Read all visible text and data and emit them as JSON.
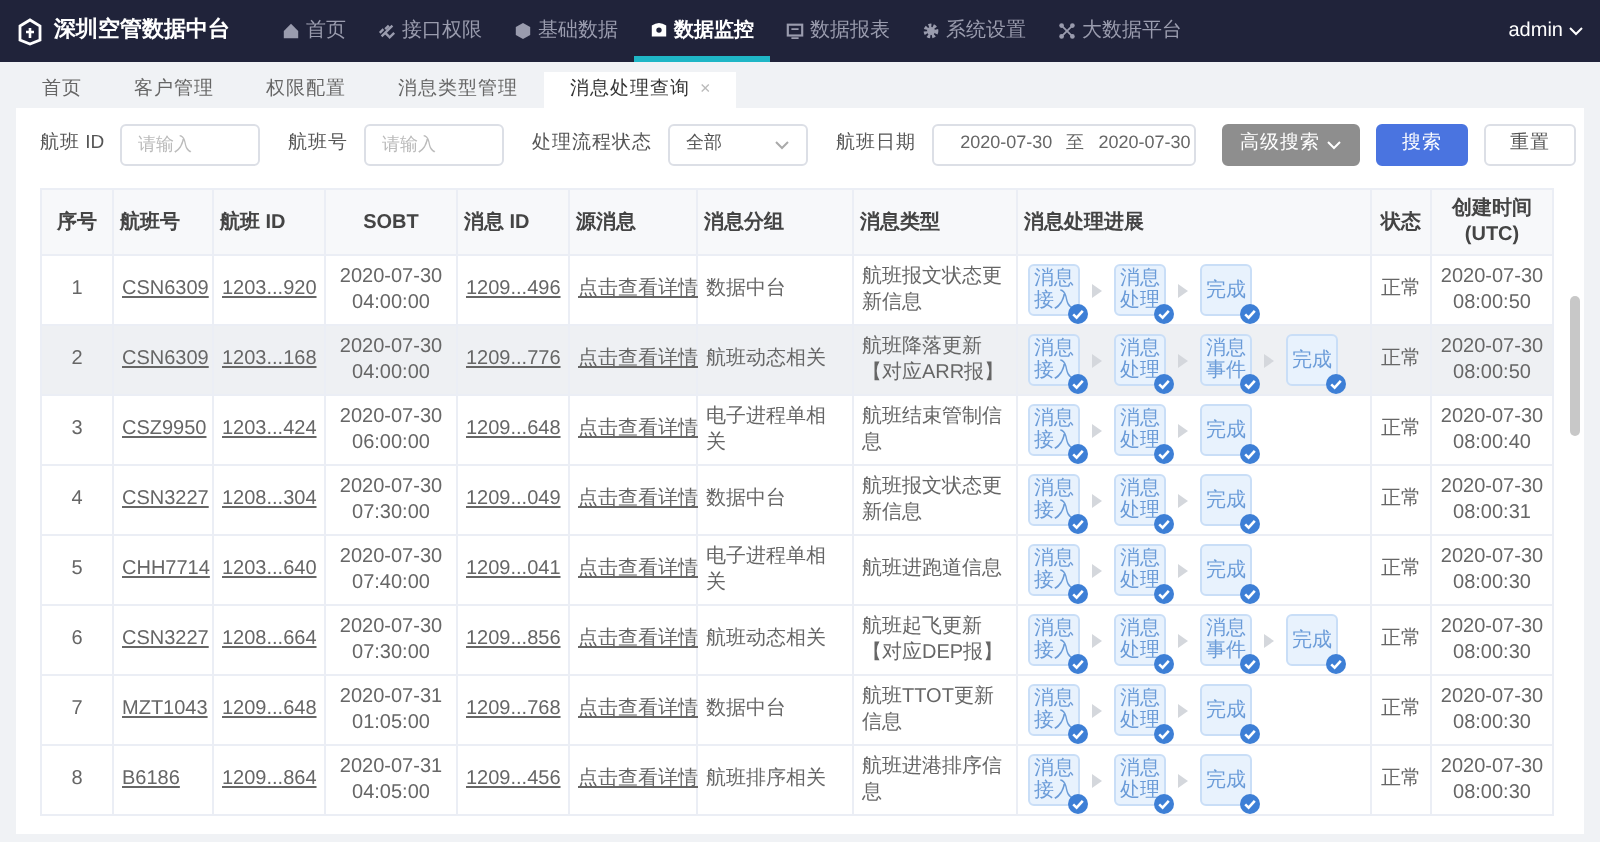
{
  "app": {
    "title": "深圳空管数据中台",
    "user": "admin"
  },
  "nav": [
    {
      "label": "首页",
      "selected": false
    },
    {
      "label": "接口权限",
      "selected": false
    },
    {
      "label": "基础数据",
      "selected": false
    },
    {
      "label": "数据监控",
      "selected": true
    },
    {
      "label": "数据报表",
      "selected": false
    },
    {
      "label": "系统设置",
      "selected": false
    },
    {
      "label": "大数据平台",
      "selected": false
    }
  ],
  "tabs": [
    {
      "label": "首页",
      "selected": false,
      "closable": false
    },
    {
      "label": "客户管理",
      "selected": false,
      "closable": false
    },
    {
      "label": "权限配置",
      "selected": false,
      "closable": false
    },
    {
      "label": "消息类型管理",
      "selected": false,
      "closable": false
    },
    {
      "label": "消息处理查询",
      "selected": true,
      "closable": true,
      "close": "×"
    }
  ],
  "filters": [
    {
      "kind": "input",
      "label": "航班 ID",
      "placeholder": "请输入"
    },
    {
      "kind": "input",
      "label": "航班号",
      "placeholder": "请输入"
    },
    {
      "kind": "select",
      "label": "处理流程状态",
      "value": "全部"
    },
    {
      "kind": "daterange",
      "label": "航班日期",
      "start": "2020-07-30",
      "separator": "至",
      "end": "2020-07-30"
    }
  ],
  "buttons": [
    {
      "label": "高级搜索",
      "kind": "dropdown"
    },
    {
      "label": "搜索",
      "kind": "primary"
    },
    {
      "label": "重置",
      "kind": "default"
    }
  ],
  "table": {
    "columns": [
      "序号",
      "航班号",
      "航班 ID",
      "SOBT",
      "消息 ID",
      "源消息",
      "消息分组",
      "消息类型",
      "消息处理进展",
      "状态",
      "创建时间 (UTC)"
    ],
    "rows": [
      {
        "highlighted": false,
        "no": "1",
        "flight_no": "CSN6309",
        "flight_id": "1203...920",
        "sobt": "2020-07-30 04:00:00",
        "msg_id": "1209...496",
        "source": "点击查看详情",
        "group": "数据中台",
        "type": "航班报文状态更新信息",
        "steps": [
          {
            "label": "消息接入",
            "done": true
          },
          {
            "label": "消息处理",
            "done": true
          },
          {
            "label": "完成",
            "done": true
          }
        ],
        "status": "正常",
        "created": "2020-07-30 08:00:50"
      },
      {
        "highlighted": true,
        "no": "2",
        "flight_no": "CSN6309",
        "flight_id": "1203...168",
        "sobt": "2020-07-30 04:00:00",
        "msg_id": "1209...776",
        "source": "点击查看详情",
        "group": "航班动态相关",
        "type": "航班降落更新【对应ARR报】",
        "steps": [
          {
            "label": "消息接入",
            "done": true
          },
          {
            "label": "消息处理",
            "done": true
          },
          {
            "label": "消息事件",
            "done": true
          },
          {
            "label": "完成",
            "done": true
          }
        ],
        "status": "正常",
        "created": "2020-07-30 08:00:50"
      },
      {
        "highlighted": false,
        "no": "3",
        "flight_no": "CSZ9950",
        "flight_id": "1203...424",
        "sobt": "2020-07-30 06:00:00",
        "msg_id": "1209...648",
        "source": "点击查看详情",
        "group": "电子进程单相关",
        "type": "航班结束管制信息",
        "steps": [
          {
            "label": "消息接入",
            "done": true
          },
          {
            "label": "消息处理",
            "done": true
          },
          {
            "label": "完成",
            "done": true
          }
        ],
        "status": "正常",
        "created": "2020-07-30 08:00:40"
      },
      {
        "highlighted": false,
        "no": "4",
        "flight_no": "CSN3227",
        "flight_id": "1208...304",
        "sobt": "2020-07-30 07:30:00",
        "msg_id": "1209...049",
        "source": "点击查看详情",
        "group": "数据中台",
        "type": "航班报文状态更新信息",
        "steps": [
          {
            "label": "消息接入",
            "done": true
          },
          {
            "label": "消息处理",
            "done": true
          },
          {
            "label": "完成",
            "done": true
          }
        ],
        "status": "正常",
        "created": "2020-07-30 08:00:31"
      },
      {
        "highlighted": false,
        "no": "5",
        "flight_no": "CHH7714",
        "flight_id": "1203...640",
        "sobt": "2020-07-30 07:40:00",
        "msg_id": "1209...041",
        "source": "点击查看详情",
        "group": "电子进程单相关",
        "type": "航班进跑道信息",
        "steps": [
          {
            "label": "消息接入",
            "done": true
          },
          {
            "label": "消息处理",
            "done": true
          },
          {
            "label": "完成",
            "done": true
          }
        ],
        "status": "正常",
        "created": "2020-07-30 08:00:30"
      },
      {
        "highlighted": false,
        "no": "6",
        "flight_no": "CSN3227",
        "flight_id": "1208...664",
        "sobt": "2020-07-30 07:30:00",
        "msg_id": "1209...856",
        "source": "点击查看详情",
        "group": "航班动态相关",
        "type": "航班起飞更新【对应DEP报】",
        "steps": [
          {
            "label": "消息接入",
            "done": true
          },
          {
            "label": "消息处理",
            "done": true
          },
          {
            "label": "消息事件",
            "done": true
          },
          {
            "label": "完成",
            "done": true
          }
        ],
        "status": "正常",
        "created": "2020-07-30 08:00:30"
      },
      {
        "highlighted": false,
        "no": "7",
        "flight_no": "MZT1043",
        "flight_id": "1209...648",
        "sobt": "2020-07-31 01:05:00",
        "msg_id": "1209...768",
        "source": "点击查看详情",
        "group": "数据中台",
        "type": "航班TTOT更新信息",
        "steps": [
          {
            "label": "消息接入",
            "done": true
          },
          {
            "label": "消息处理",
            "done": true
          },
          {
            "label": "完成",
            "done": true
          }
        ],
        "status": "正常",
        "created": "2020-07-30 08:00:30"
      },
      {
        "highlighted": false,
        "no": "8",
        "flight_no": "B6186",
        "flight_id": "1209...864",
        "sobt": "2020-07-31 04:05:00",
        "msg_id": "1209...456",
        "source": "点击查看详情",
        "group": "航班排序相关",
        "type": "航班进港排序信息",
        "steps": [
          {
            "label": "消息接入",
            "done": true
          },
          {
            "label": "消息处理",
            "done": true
          },
          {
            "label": "完成",
            "done": true
          }
        ],
        "status": "正常",
        "created": "2020-07-30 08:00:30"
      }
    ]
  }
}
